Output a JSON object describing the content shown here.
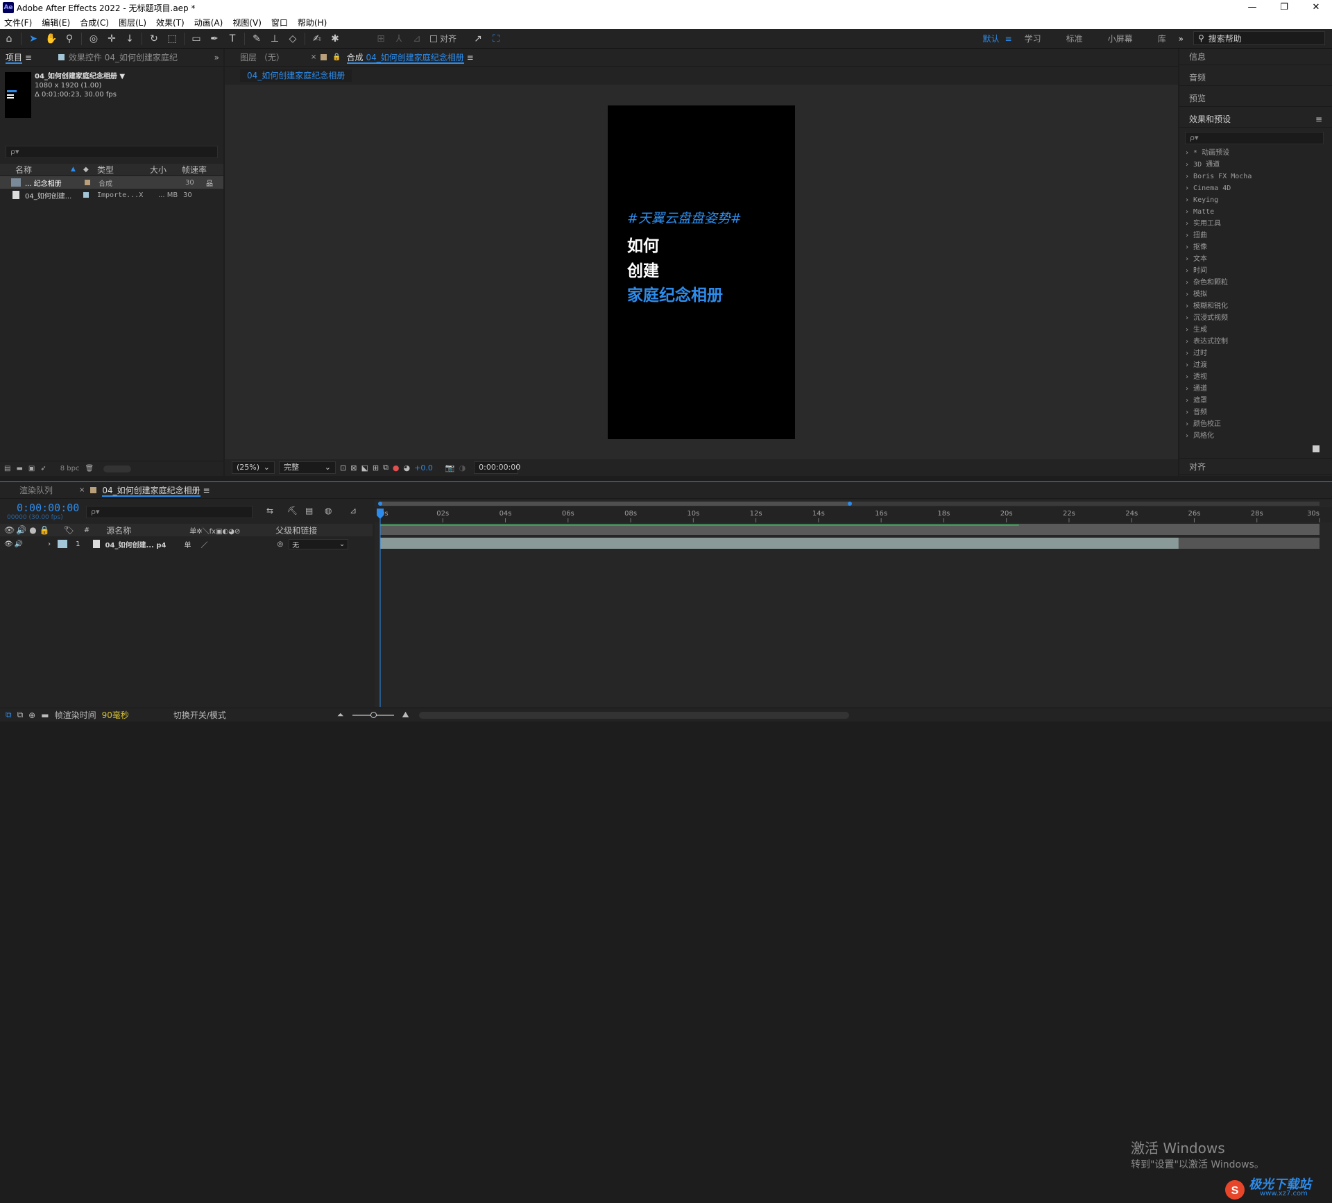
{
  "window": {
    "title": "Adobe After Effects 2022 - 无标题项目.aep *",
    "app_icon": "Ae",
    "buttons": {
      "minimize": "—",
      "restore": "❐",
      "close": "✕"
    }
  },
  "menu": [
    "文件(F)",
    "编辑(E)",
    "合成(C)",
    "图层(L)",
    "效果(T)",
    "动画(A)",
    "视图(V)",
    "窗口",
    "帮助(H)"
  ],
  "toolbar": {
    "align_label": "对齐",
    "workspaces": [
      "默认",
      "学习",
      "标准",
      "小屏幕",
      "库"
    ],
    "active_workspace": "默认",
    "more": "»",
    "help_search": "搜索帮助"
  },
  "project_panel": {
    "tab_project": "项目",
    "tab_effects": "效果控件 04_如何创建家庭纪",
    "comp_name": "04_如何创建家庭纪念相册",
    "comp_size": "1080 x 1920 (1.00)",
    "comp_duration": "Δ 0:01:00:23, 30.00 fps",
    "search_placeholder": "ρ▾",
    "columns": {
      "name": "名称",
      "type": "类型",
      "size": "大小",
      "fps": "帧速率"
    },
    "items": [
      {
        "name": "... 纪念相册",
        "type": "合成",
        "size": "",
        "fps": "30",
        "color": "#b99f7a"
      },
      {
        "name": "04_如何创建...",
        "type": "Importe...X",
        "size": "... MB",
        "fps": "30",
        "color": "#a3c5d8"
      }
    ],
    "bpc": "8 bpc"
  },
  "comp_panel": {
    "tab_layer": "图层 （无）",
    "tab_comp_prefix": "合成",
    "tab_comp_name": "04_如何创建家庭纪念相册",
    "sub_tab": "04_如何创建家庭纪念相册",
    "canvas_text": {
      "line1": "#天翼云盘盘姿势#",
      "line2": "如何",
      "line3": "创建",
      "line4": "家庭纪念相册"
    },
    "zoom": "(25%)",
    "resolution": "完整",
    "exposure": "+0.0",
    "timecode": "0:00:00:00"
  },
  "right_panel": {
    "info": "信息",
    "audio": "音频",
    "preview": "预览",
    "effects": "效果和预设",
    "search_placeholder": "ρ▾",
    "align": "对齐",
    "fx_items": [
      "* 动画预设",
      "3D 通道",
      "Boris FX Mocha",
      "Cinema 4D",
      "Keying",
      "Matte",
      "实用工具",
      "扭曲",
      "抠像",
      "文本",
      "时间",
      "杂色和颗粒",
      "模拟",
      "模糊和锐化",
      "沉浸式视频",
      "生成",
      "表达式控制",
      "过时",
      "过渡",
      "透视",
      "通道",
      "遮罩",
      "音频",
      "颜色校正",
      "风格化"
    ]
  },
  "timeline": {
    "tab_render": "渲染队列",
    "tab_comp": "04_如何创建家庭纪念相册",
    "timecode": "0:00:00:00",
    "frame_info": "00000 (30.00 fps)",
    "search_placeholder": "ρ▾",
    "columns": {
      "hash": "#",
      "source": "源名称",
      "parent": "父级和链接"
    },
    "layer": {
      "index": "1",
      "name": "04_如何创建... p4",
      "parent": "无"
    },
    "ruler": [
      "0s",
      "02s",
      "04s",
      "06s",
      "08s",
      "10s",
      "12s",
      "14s",
      "16s",
      "18s",
      "20s",
      "22s",
      "24s",
      "26s",
      "28s",
      "30s"
    ],
    "work_area_end_fraction": 0.5,
    "layer_bar_end_fraction": 0.85,
    "green_bar_end_fraction": 0.68,
    "footer_render_label": "帧渲染时间",
    "footer_render_value": "90毫秒",
    "footer_toggle": "切换开关/模式"
  },
  "watermark": {
    "line1": "激活 Windows",
    "line2": "转到\"设置\"以激活 Windows。"
  },
  "brand": {
    "name": "极光下载站",
    "url": "www.xz7.com"
  },
  "colors": {
    "accent": "#2d8ceb",
    "green": "#2aa84a"
  }
}
